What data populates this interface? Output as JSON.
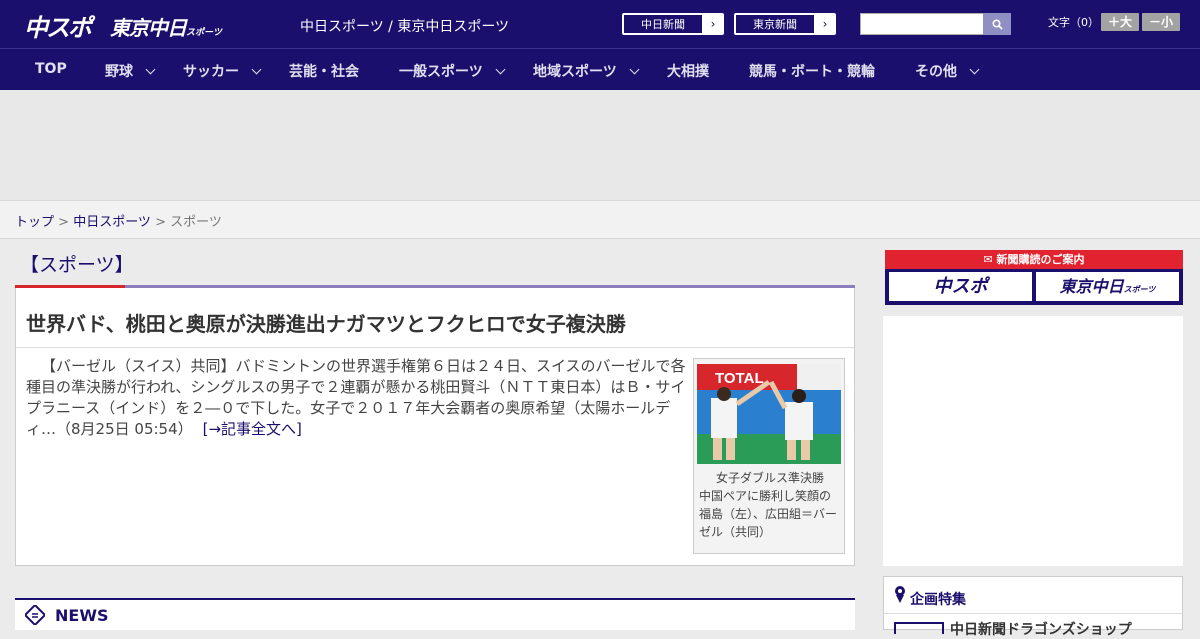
{
  "header": {
    "logo_chuspo": "中スポ",
    "logo_tokyo": "東京中日",
    "logo_tokyo_sub": "スポーツ",
    "site_links": "中日スポーツ / 東京中日スポーツ",
    "chunichi_link": "中日新聞",
    "tokyo_link": "東京新聞",
    "search_placeholder": "",
    "text_size_label": "文字（0）",
    "size_up": "＋大",
    "size_down": "－小",
    "colors": {
      "brand": "#1b0f6e",
      "accent_red": "#d6262e"
    }
  },
  "nav": {
    "items": [
      {
        "label": "TOP",
        "dropdown": false
      },
      {
        "label": "野球",
        "dropdown": true
      },
      {
        "label": "サッカー",
        "dropdown": true
      },
      {
        "label": "芸能・社会",
        "dropdown": false
      },
      {
        "label": "一般スポーツ",
        "dropdown": true
      },
      {
        "label": "地域スポーツ",
        "dropdown": true
      },
      {
        "label": "大相撲",
        "dropdown": false
      },
      {
        "label": "競馬・ボート・競輪",
        "dropdown": false
      },
      {
        "label": "その他",
        "dropdown": true
      }
    ]
  },
  "breadcrumb": {
    "top": "トップ",
    "sep1": " > ",
    "chuspo": "中日スポーツ",
    "sep2": " > ",
    "current": "スポーツ"
  },
  "main": {
    "section_title": "【スポーツ】",
    "article": {
      "title": "世界バド、桃田と奥原が決勝進出ナガマツとフクヒロで女子複決勝",
      "body": "【バーゼル（スイス）共同】バドミントンの世界選手権第６日は２４日、スイスのバーゼルで各種目の準決勝が行われ、シングルスの男子で２連覇が懸かる桃田賢斗（ＮＴＴ東日本）はＢ・サイプラニース（インド）を２―０で下した。女子で２０１７年大会覇者の奥原希望（太陽ホールディ…（8月25日 05:54）",
      "more_link": "[→記事全文へ]",
      "photo_caption_first": "女子ダブルス準決勝",
      "photo_caption_rest": "中国ペアに勝利し笑顔の福島（左）、広田組＝バーゼル（共同）",
      "photo_banner_text": "TOTAL"
    },
    "news_label": "NEWS"
  },
  "sidebar": {
    "subscription_label": "新聞購読のご案内",
    "sub_chuspo": "中スポ",
    "sub_tokyo": "東京中日",
    "sub_tokyo_small": "スポーツ",
    "kikaku_label": "企画特集",
    "kikaku_item": "中日新聞ドラゴンズショップ"
  }
}
